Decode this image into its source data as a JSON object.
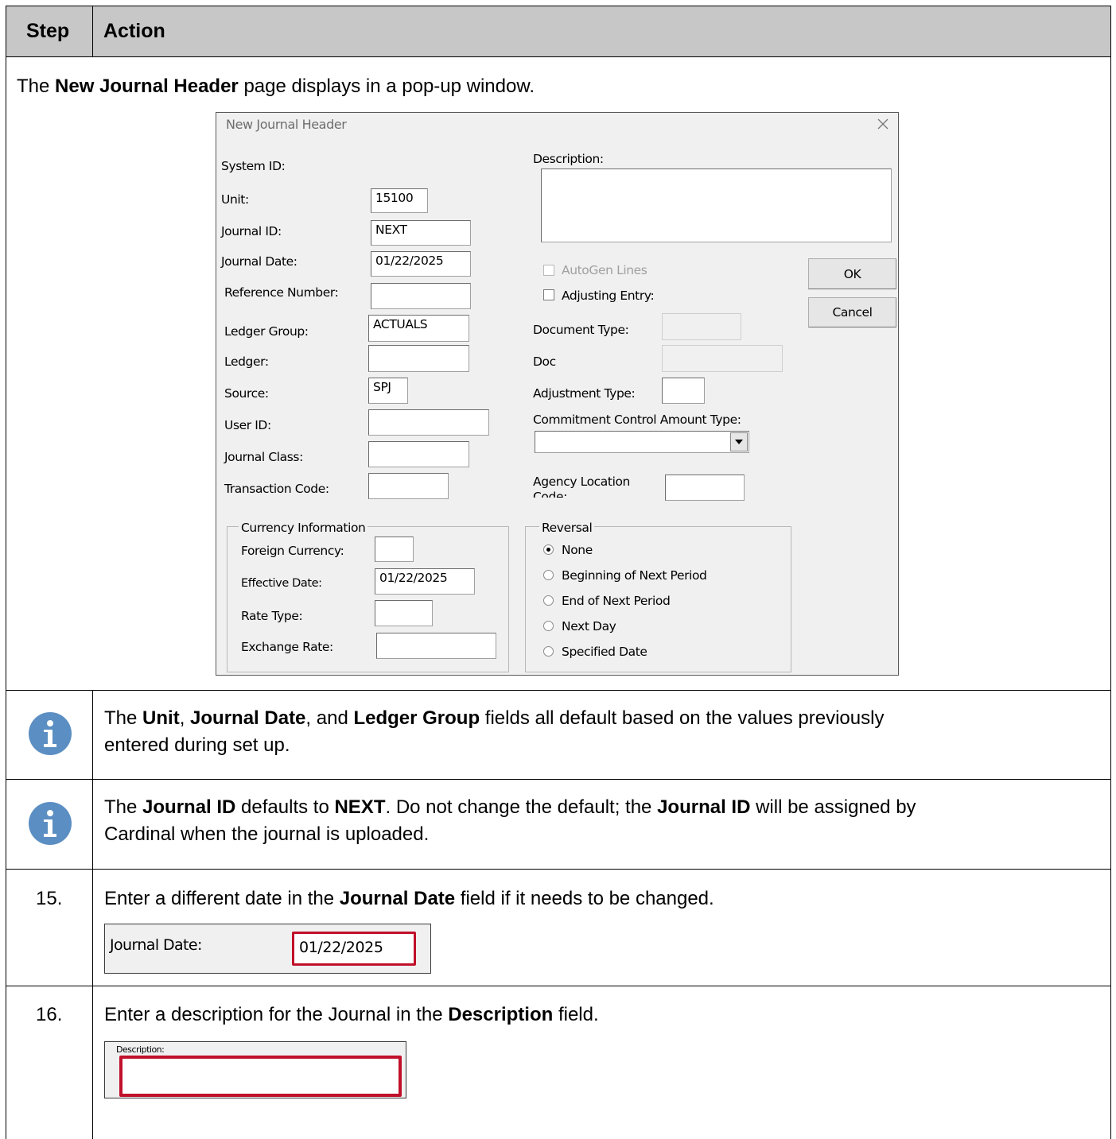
{
  "table": {
    "header": {
      "step": "Step",
      "action": "Action"
    },
    "intro": {
      "pre": "The ",
      "bold": "New Journal Header",
      "post": " page displays in a pop-up window."
    },
    "note1": {
      "line1_parts": [
        "The ",
        "Unit",
        ", ",
        "Journal Date",
        ", and ",
        "Ledger Group",
        " fields all default based on the values previously"
      ],
      "line2": "entered during set up."
    },
    "note2": {
      "line1_parts": [
        "The ",
        "Journal ID",
        " defaults to ",
        "NEXT",
        ". Do not change the default; the ",
        "Journal ID",
        " will be assigned by"
      ],
      "line2": "Cardinal when the journal is uploaded."
    },
    "step15": {
      "num": "15.",
      "pre": "Enter a different date in the ",
      "bold": "Journal Date",
      "post": " field if it needs to be changed."
    },
    "step16": {
      "num": "16.",
      "pre": "Enter a description for the Journal in the ",
      "bold": "Description",
      "post": " field."
    }
  },
  "dialog": {
    "title": "New Journal Header",
    "close_icon": "close-icon",
    "labels": {
      "system_id": "System ID:",
      "unit": "Unit:",
      "journal_id": "Journal ID:",
      "journal_date": "Journal Date:",
      "reference_number": "Reference Number:",
      "ledger_group": "Ledger Group:",
      "ledger": "Ledger:",
      "source": "Source:",
      "user_id": "User ID:",
      "journal_class": "Journal Class:",
      "transaction_code": "Transaction Code:",
      "description": "Description:",
      "autogen_lines": "AutoGen Lines",
      "adjusting_entry": "Adjusting Entry:",
      "document_type": "Document Type:",
      "doc": "Doc",
      "adjustment_type": "Adjustment Type:",
      "commitment_control": "Commitment Control Amount Type:",
      "agency_location_1": "Agency Location",
      "agency_location_2": "Code:"
    },
    "values": {
      "unit": "15100",
      "journal_id": "NEXT",
      "journal_date": "01/22/2025",
      "ledger_group": "ACTUALS",
      "source": "SPJ"
    },
    "buttons": {
      "ok": "OK",
      "cancel": "Cancel"
    },
    "currency": {
      "legend": "Currency Information",
      "foreign_currency": "Foreign Currency:",
      "effective_date": "Effective Date:",
      "effective_date_value": "01/22/2025",
      "rate_type": "Rate Type:",
      "exchange_rate": "Exchange Rate:"
    },
    "reversal": {
      "legend": "Reversal",
      "options": [
        "None",
        "Beginning of Next Period",
        "End of Next Period",
        "Next Day",
        "Specified Date"
      ],
      "selected": "None"
    }
  },
  "snippet_journal_date": {
    "label": "Journal Date:",
    "value": "01/22/2025",
    "highlight_color": "#c0102a"
  },
  "snippet_description": {
    "label": "Description:",
    "highlight_color": "#c0102a"
  }
}
